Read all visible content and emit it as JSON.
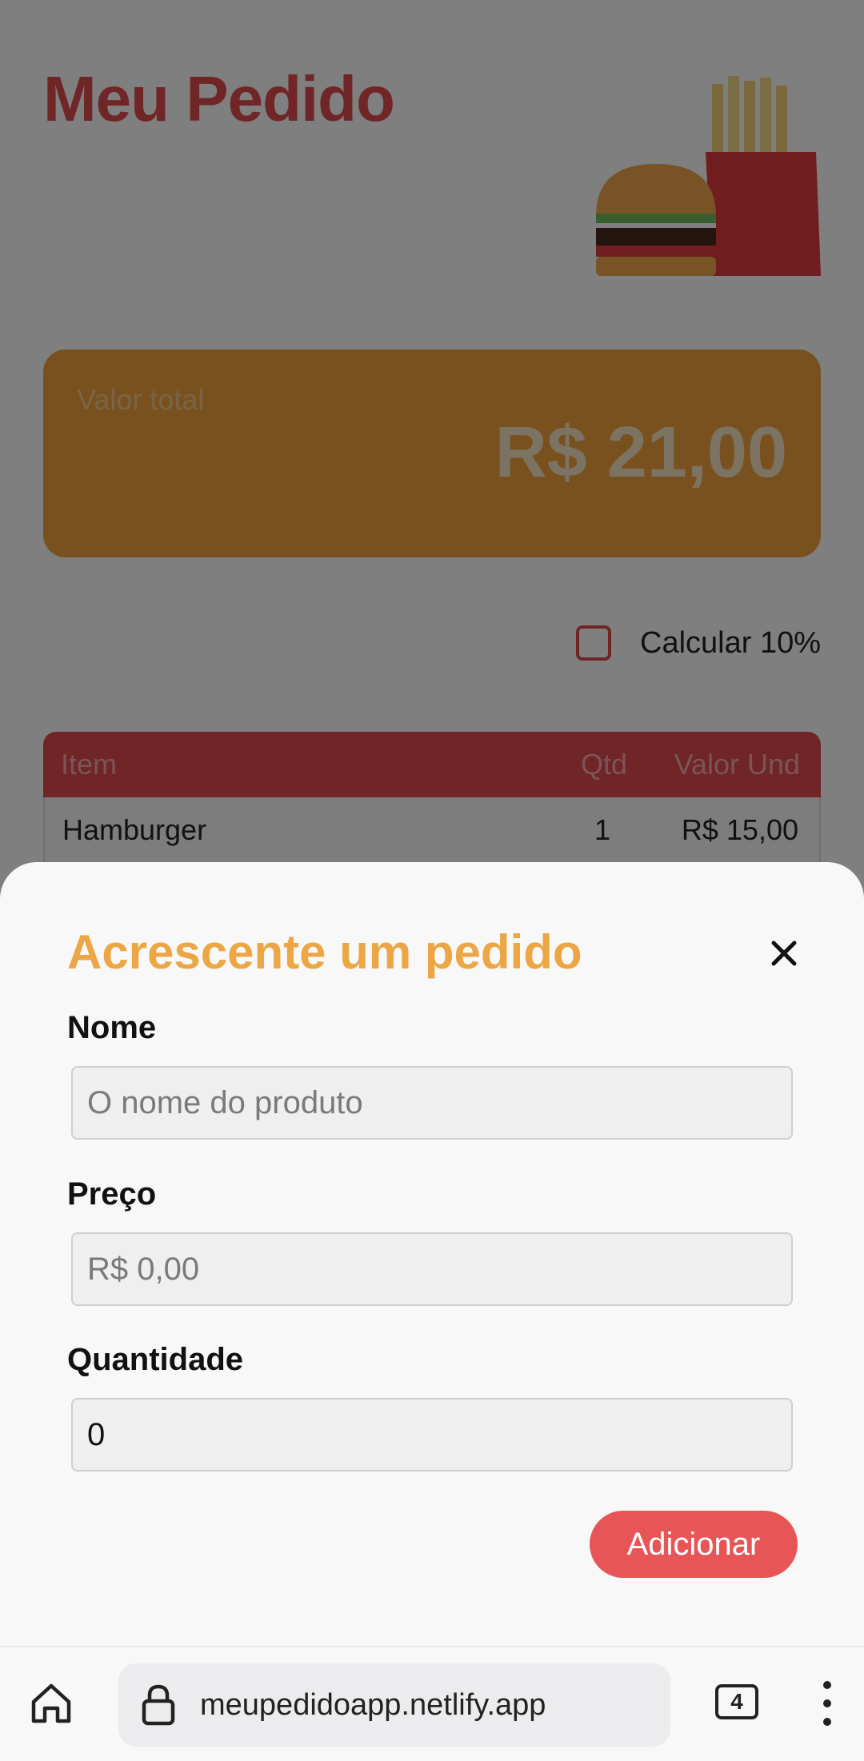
{
  "background_page": {
    "title": "Meu Pedido",
    "total": {
      "label": "Valor total",
      "value": "R$ 21,00"
    },
    "tip_checkbox": {
      "label": "Calcular 10%",
      "checked": false
    },
    "table": {
      "headers": [
        "Item",
        "Qtd",
        "Valor Und"
      ],
      "rows": [
        {
          "item": "Hamburger",
          "qtd": "1",
          "valor": "R$ 15,00"
        }
      ]
    }
  },
  "sheet": {
    "title": "Acrescente um pedido",
    "close_icon": "close-icon",
    "fields": {
      "nome": {
        "label": "Nome",
        "placeholder": "O nome do produto",
        "value": ""
      },
      "preco": {
        "label": "Preço",
        "placeholder": "R$ 0,00",
        "value": ""
      },
      "quantidade": {
        "label": "Quantidade",
        "value": "0"
      }
    },
    "submit_label": "Adicionar"
  },
  "browser": {
    "url": "meupedidoapp.netlify.app",
    "tab_count": "4",
    "icons": [
      "home-icon",
      "lock-icon",
      "tabs-icon",
      "more-vert-icon"
    ]
  },
  "colors": {
    "brand_red": "#e04a4f",
    "accent_orange": "#eca644",
    "button_red": "#e85557"
  }
}
